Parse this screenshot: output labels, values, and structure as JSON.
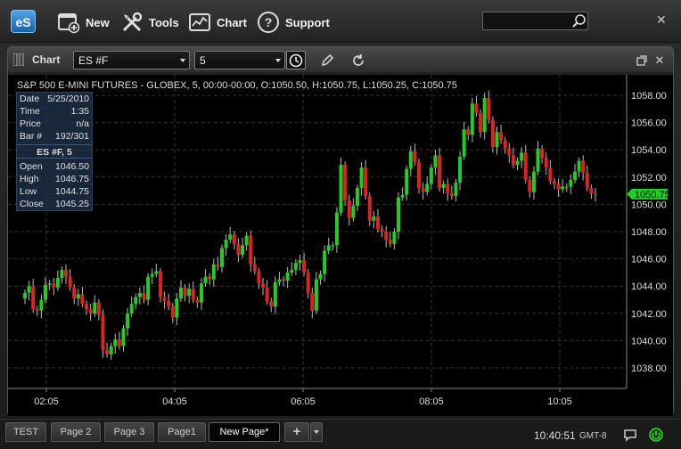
{
  "app": {
    "logo_text": "eS",
    "toolbar": [
      {
        "label": "New",
        "icon": "new-window-icon"
      },
      {
        "label": "Tools",
        "icon": "tools-icon"
      },
      {
        "label": "Chart",
        "icon": "chart-icon"
      },
      {
        "label": "Support",
        "icon": "help-icon"
      }
    ],
    "search_value": ""
  },
  "window": {
    "title": "Chart",
    "symbol": "ES #F",
    "interval": "5"
  },
  "chart_header": "S&P 500 E-MINI FUTURES - GLOBEX, 5, 00:00-00:00, O:1050.50, H:1050.75, L:1050.25, C:1050.75",
  "infobox": {
    "rows1": [
      {
        "k": "Date",
        "v": "5/25/2010"
      },
      {
        "k": "Time",
        "v": "1:35"
      },
      {
        "k": "Price",
        "v": "n/a"
      },
      {
        "k": "Bar #",
        "v": "192/301"
      }
    ],
    "header": "ES #F, 5",
    "rows2": [
      {
        "k": "Open",
        "v": "1046.50"
      },
      {
        "k": "High",
        "v": "1046.75"
      },
      {
        "k": "Low",
        "v": "1044.75"
      },
      {
        "k": "Close",
        "v": "1045.25"
      }
    ]
  },
  "chart_data": {
    "type": "candlestick",
    "ylim": [
      1036.5,
      1059.5
    ],
    "y_ticks": [
      "1058.00",
      "1056.00",
      "1054.00",
      "1052.00",
      "1050.00",
      "1048.00",
      "1046.00",
      "1044.00",
      "1042.00",
      "1040.00",
      "1038.00"
    ],
    "y_tick_values": [
      1058,
      1056,
      1054,
      1052,
      1050,
      1048,
      1046,
      1044,
      1042,
      1040,
      1038
    ],
    "x_ticks": [
      "02:05",
      "04:05",
      "06:05",
      "08:05",
      "10:05"
    ],
    "last_price_label": "1050.75",
    "up_color": "#22cc22",
    "down_color": "#dd2222",
    "closes": [
      1043.5,
      1044.0,
      1042.3,
      1042.2,
      1043.0,
      1044.1,
      1044.2,
      1043.9,
      1044.6,
      1045.2,
      1044.7,
      1043.9,
      1043.1,
      1043.4,
      1042.7,
      1042.3,
      1042.0,
      1042.8,
      1041.9,
      1039.3,
      1039.0,
      1039.6,
      1040.1,
      1039.6,
      1040.9,
      1042.0,
      1042.7,
      1043.2,
      1043.5,
      1043.0,
      1044.7,
      1044.9,
      1045.1,
      1043.2,
      1042.9,
      1042.5,
      1041.7,
      1043.1,
      1043.9,
      1043.3,
      1043.8,
      1043.0,
      1042.8,
      1044.2,
      1044.7,
      1044.5,
      1045.6,
      1045.4,
      1046.8,
      1047.4,
      1047.8,
      1047.1,
      1046.3,
      1047.0,
      1047.7,
      1045.6,
      1045.1,
      1044.2,
      1043.9,
      1042.9,
      1042.5,
      1044.3,
      1044.5,
      1044.4,
      1045.0,
      1045.2,
      1045.7,
      1045.9,
      1045.0,
      1043.5,
      1042.2,
      1044.5,
      1044.9,
      1046.6,
      1047.0,
      1047.0,
      1049.4,
      1052.9,
      1050.3,
      1049.0,
      1049.9,
      1051.2,
      1052.7,
      1050.6,
      1048.8,
      1049.1,
      1048.2,
      1048.0,
      1047.4,
      1047.1,
      1048.0,
      1050.5,
      1050.7,
      1052.6,
      1053.9,
      1053.1,
      1051.2,
      1050.9,
      1051.5,
      1052.7,
      1053.6,
      1051.2,
      1051.5,
      1050.8,
      1050.6,
      1051.6,
      1053.5,
      1055.5,
      1055.1,
      1057.4,
      1056.7,
      1055.3,
      1057.8,
      1056.2,
      1054.2,
      1055.3,
      1054.7,
      1054.1,
      1053.6,
      1052.9,
      1053.2,
      1053.8,
      1051.8,
      1050.9,
      1052.4,
      1054.1,
      1053.4,
      1052.7,
      1051.7,
      1051.5,
      1051.1,
      1051.3,
      1051.3,
      1051.8,
      1052.4,
      1053.2,
      1052.3,
      1051.2,
      1050.8,
      1050.75
    ]
  },
  "tabs": [
    {
      "label": "TEST",
      "active": false
    },
    {
      "label": "Page 2",
      "active": false
    },
    {
      "label": "Page 3",
      "active": false
    },
    {
      "label": "Page1",
      "active": false
    },
    {
      "label": "New Page*",
      "active": true
    }
  ],
  "status": {
    "time": "10:40:51",
    "tz": "GMT-8"
  }
}
